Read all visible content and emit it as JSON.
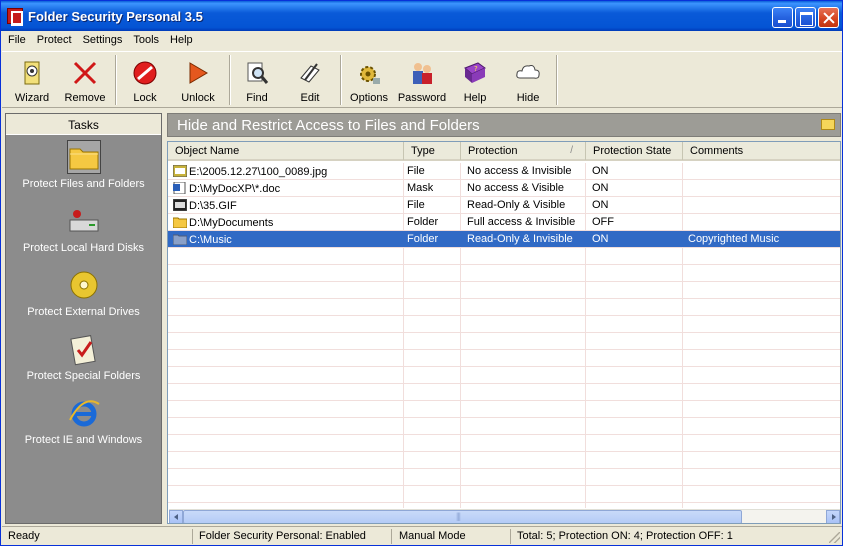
{
  "window": {
    "title": "Folder Security Personal 3.5"
  },
  "menu": [
    "File",
    "Protect",
    "Settings",
    "Tools",
    "Help"
  ],
  "toolbar": {
    "wizard": "Wizard",
    "remove": "Remove",
    "lock": "Lock",
    "unlock": "Unlock",
    "find": "Find",
    "edit": "Edit",
    "options": "Options",
    "password": "Password",
    "help": "Help",
    "hide": "Hide"
  },
  "tasks": {
    "header": "Tasks",
    "items": [
      {
        "label": "Protect Files and Folders"
      },
      {
        "label": "Protect Local Hard Disks"
      },
      {
        "label": "Protect External Drives"
      },
      {
        "label": "Protect Special Folders"
      },
      {
        "label": "Protect IE and Windows"
      }
    ]
  },
  "banner": {
    "title": "Hide and Restrict Access to Files and Folders"
  },
  "table": {
    "columns": [
      "Object Name",
      "Type",
      "Protection",
      "Protection State",
      "Comments"
    ],
    "sort_mark": "/",
    "rows": [
      {
        "icon": "jpg-file-icon",
        "name": "E:\\2005.12.27\\100_0089.jpg",
        "type": "File",
        "protection": "No access & Invisible",
        "state": "ON",
        "comment": ""
      },
      {
        "icon": "word-doc-icon",
        "name": "D:\\MyDocXP\\*.doc",
        "type": "Mask",
        "protection": "No access & Visible",
        "state": "ON",
        "comment": ""
      },
      {
        "icon": "gif-file-icon",
        "name": "D:\\35.GIF",
        "type": "File",
        "protection": "Read-Only & Visible",
        "state": "ON",
        "comment": ""
      },
      {
        "icon": "folder-icon",
        "name": "D:\\MyDocuments",
        "type": "Folder",
        "protection": "Full access & Invisible",
        "state": "OFF",
        "comment": ""
      },
      {
        "icon": "folder-icon",
        "name": "C:\\Music",
        "type": "Folder",
        "protection": "Read-Only & Invisible",
        "state": "ON",
        "comment": "Copyrighted Music"
      }
    ]
  },
  "status": {
    "ready": "Ready",
    "enabled": "Folder Security Personal: Enabled",
    "mode": "Manual Mode",
    "counts": "Total: 5;   Protection ON: 4;   Protection OFF: 1"
  },
  "colors": {
    "selection": "#316ac5",
    "titlebar": "#0454d4",
    "panel": "#8c8c8c",
    "banner": "#9d9c96"
  }
}
